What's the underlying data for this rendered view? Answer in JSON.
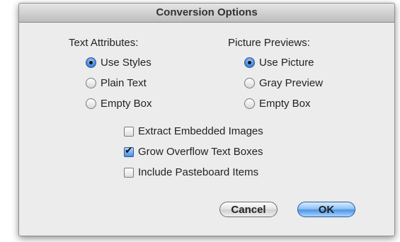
{
  "dialog": {
    "title": "Conversion Options"
  },
  "text_attributes": {
    "heading": "Text Attributes:",
    "options": [
      {
        "label": "Use Styles",
        "selected": true
      },
      {
        "label": "Plain Text",
        "selected": false
      },
      {
        "label": "Empty Box",
        "selected": false
      }
    ]
  },
  "picture_previews": {
    "heading": "Picture Previews:",
    "options": [
      {
        "label": "Use Picture",
        "selected": true
      },
      {
        "label": "Gray Preview",
        "selected": false
      },
      {
        "label": "Empty Box",
        "selected": false
      }
    ]
  },
  "checkboxes": [
    {
      "label": "Extract Embedded Images",
      "checked": false
    },
    {
      "label": "Grow Overflow Text Boxes",
      "checked": true
    },
    {
      "label": "Include Pasteboard Items",
      "checked": false
    }
  ],
  "buttons": {
    "cancel": "Cancel",
    "ok": "OK"
  },
  "colors": {
    "accent": "#4f8fe0",
    "dialog_bg": "#ececec"
  }
}
